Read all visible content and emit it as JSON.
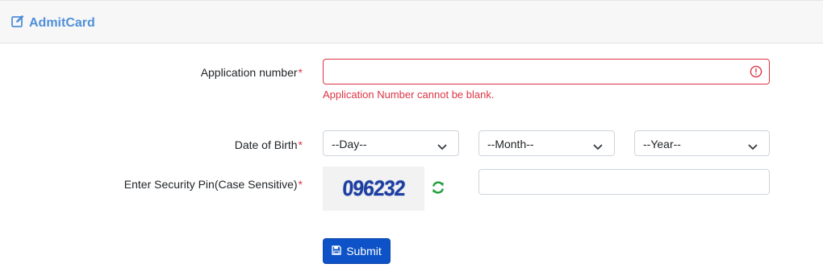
{
  "header": {
    "title": "AdmitCard",
    "icon": "edit-icon"
  },
  "form": {
    "application_number": {
      "label": "Application number",
      "required_mark": "*",
      "value": "",
      "error": "Application Number cannot be blank."
    },
    "dob": {
      "label": "Date of Birth",
      "required_mark": "*",
      "day": "--Day--",
      "month": "--Month--",
      "year": "--Year--"
    },
    "security_pin": {
      "label": "Enter Security Pin(Case Sensitive)",
      "required_mark": "*",
      "captcha_text": "096232",
      "value": ""
    },
    "submit_label": "Submit"
  },
  "colors": {
    "accent": "#0d52c6",
    "error": "#dc3545",
    "header_title": "#4f8fd9",
    "refresh": "#1e9e3a"
  }
}
